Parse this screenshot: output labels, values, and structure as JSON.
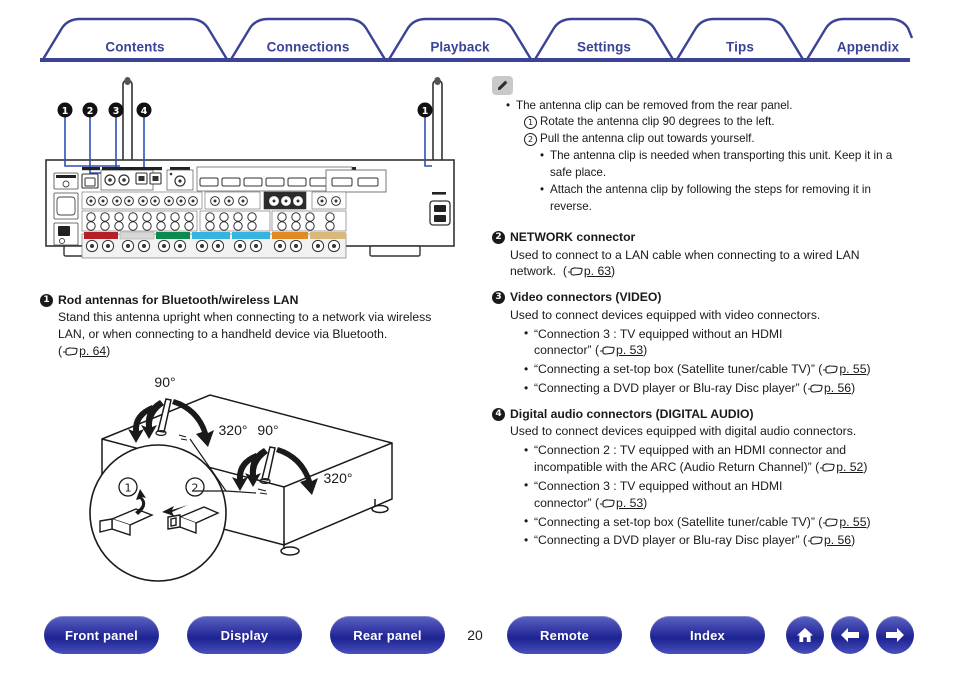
{
  "header": {
    "tabs": [
      {
        "label": "Contents"
      },
      {
        "label": "Connections"
      },
      {
        "label": "Playback"
      },
      {
        "label": "Settings"
      },
      {
        "label": "Tips"
      },
      {
        "label": "Appendix"
      }
    ],
    "accent_color": "#3a4395"
  },
  "left_column": {
    "figure_rear_panel": {
      "caption_markers": [
        "1",
        "2",
        "3",
        "4",
        "1"
      ],
      "speaker_band_colors": [
        "#b41f28",
        "#d8d8d8",
        "#0a8a4f",
        "#37b3e0",
        "#37b3e0",
        "#e08a22",
        "#d9b97a"
      ],
      "leader_line_color": "#2f4fb5"
    },
    "item1": {
      "num": "1",
      "title": "Rod antennas for Bluetooth/wireless LAN",
      "body_line1": "Stand this antenna upright when connecting to a network via wireless",
      "body_line2": "LAN, or when connecting to a handheld device via Bluetooth.",
      "link_page": "p. 64"
    },
    "figure_antenna": {
      "angle_labels": [
        "90°",
        "320°",
        "90°",
        "320°"
      ],
      "step_labels": [
        "1",
        "2"
      ]
    }
  },
  "right_column": {
    "note": {
      "icon": "pencil-icon",
      "bullet1": "The antenna clip can be removed from the rear panel.",
      "step1_num": "1",
      "step1": "Rotate the antenna clip 90 degrees to the left.",
      "step2_num": "2",
      "step2": "Pull the antenna clip out towards yourself.",
      "sub1": "The antenna clip is needed when transporting this unit. Keep it in a safe place.",
      "sub2": "Attach the antenna clip by following the steps for removing it in reverse."
    },
    "item2": {
      "num": "2",
      "title": "NETWORK connector",
      "body_line1": "Used to connect to a LAN cable when connecting to a wired LAN",
      "body_line2": "network.",
      "link_page": "p. 63"
    },
    "item3": {
      "num": "3",
      "title": "Video connectors (VIDEO)",
      "body": "Used to connect devices equipped with video connectors.",
      "bullets": [
        {
          "text_line1": "“Connection 3 : TV equipped without an HDMI",
          "text_line2": "connector”",
          "link_page": "p. 53"
        },
        {
          "text_line1": "“Connecting a set-top box (Satellite tuner/cable TV)”",
          "text_line2": "",
          "link_page": "p. 55"
        },
        {
          "text_line1": "“Connecting a DVD player or Blu-ray Disc player”",
          "text_line2": "",
          "link_page": "p. 56"
        }
      ]
    },
    "item4": {
      "num": "4",
      "title": "Digital audio connectors (DIGITAL AUDIO)",
      "body": "Used to connect devices equipped with digital audio connectors.",
      "bullets": [
        {
          "text_line1": "“Connection 2 : TV equipped with an HDMI connector and",
          "text_line2": "incompatible with the ARC (Audio Return Channel)”",
          "link_page": "p. 52"
        },
        {
          "text_line1": "“Connection 3 : TV equipped without an HDMI",
          "text_line2": "connector”",
          "link_page": "p. 53"
        },
        {
          "text_line1": "“Connecting a set-top box (Satellite tuner/cable TV)”",
          "text_line2": "",
          "link_page": "p. 55"
        },
        {
          "text_line1": "“Connecting a DVD player or Blu-ray Disc player”",
          "text_line2": "",
          "link_page": "p. 56"
        }
      ]
    }
  },
  "footer": {
    "buttons": [
      {
        "label": "Front panel"
      },
      {
        "label": "Display"
      },
      {
        "label": "Rear panel"
      },
      {
        "label": "Remote"
      },
      {
        "label": "Index"
      }
    ],
    "page_number": "20",
    "icons": [
      "home-icon",
      "arrow-left-icon",
      "arrow-right-icon"
    ],
    "button_color": "#2f34a0"
  }
}
